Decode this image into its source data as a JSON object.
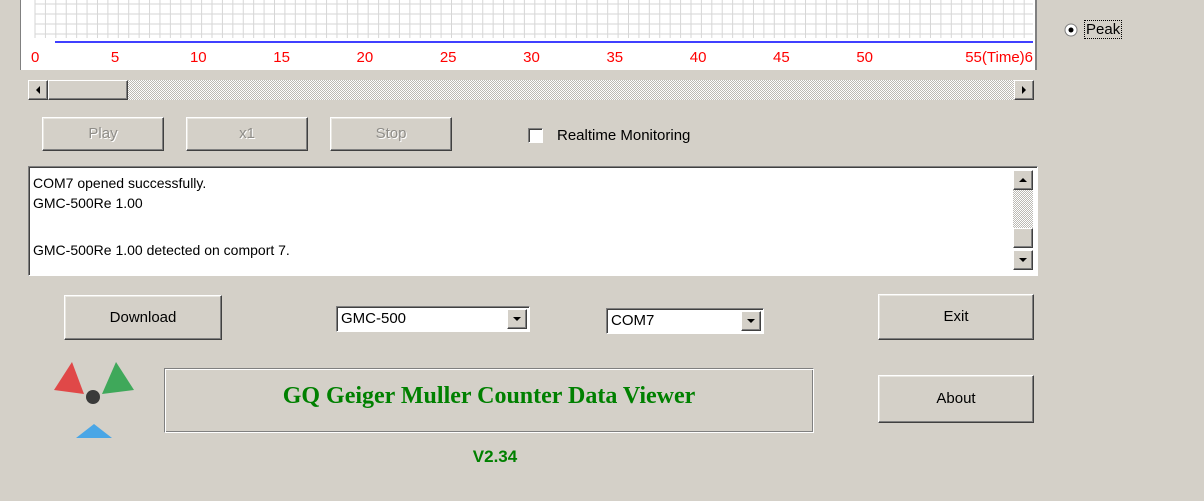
{
  "colors": {
    "axis_label": "#ff0000",
    "series_line": "#0000ff",
    "title_green": "#008000",
    "window_bg": "#d4d0c8"
  },
  "chart": {
    "tick_labels": [
      "0",
      "5",
      "10",
      "15",
      "20",
      "25",
      "30",
      "35",
      "40",
      "45",
      "50",
      "55(Time)6"
    ],
    "series_value": 0,
    "grid": true
  },
  "display_mode": {
    "label": "Peak",
    "selected": true
  },
  "playback": {
    "play_label": "Play",
    "speed_label": "x1",
    "stop_label": "Stop",
    "enabled": false
  },
  "realtime": {
    "label": "Realtime Monitoring",
    "checked": false
  },
  "log": {
    "lines": [
      "COM7 opened successfully.",
      "GMC-500Re 1.00",
      "",
      "GMC-500Re 1.00 detected on comport 7."
    ]
  },
  "download_label": "Download",
  "model_select": {
    "value": "GMC-500"
  },
  "port_select": {
    "value": "COM7"
  },
  "exit_label": "Exit",
  "about_label": "About",
  "app_title": "GQ Geiger Muller Counter Data Viewer",
  "version": "V2.34",
  "icons": {
    "logo": "radiation-trefoil-icon",
    "scroll_left": "arrow-left-icon",
    "scroll_right": "arrow-right-icon",
    "scroll_up": "arrow-up-icon",
    "scroll_down": "arrow-down-icon",
    "dropdown": "chevron-down-icon"
  }
}
